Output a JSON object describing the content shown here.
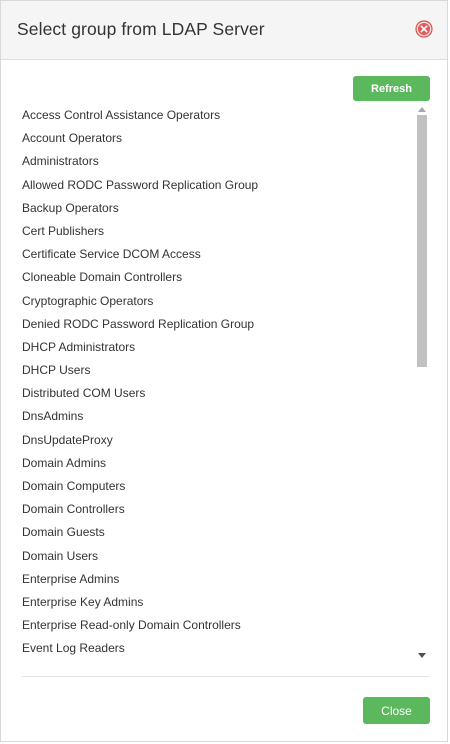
{
  "dialog": {
    "title": "Select group from LDAP Server",
    "close_icon": "close-circle-icon",
    "accent_color": "#5cb85c",
    "close_icon_color": "#e25c5c"
  },
  "toolbar": {
    "refresh_label": "Refresh"
  },
  "groups": [
    "Access Control Assistance Operators",
    "Account Operators",
    "Administrators",
    "Allowed RODC Password Replication Group",
    "Backup Operators",
    "Cert Publishers",
    "Certificate Service DCOM Access",
    "Cloneable Domain Controllers",
    "Cryptographic Operators",
    "Denied RODC Password Replication Group",
    "DHCP Administrators",
    "DHCP Users",
    "Distributed COM Users",
    "DnsAdmins",
    "DnsUpdateProxy",
    "Domain Admins",
    "Domain Computers",
    "Domain Controllers",
    "Domain Guests",
    "Domain Users",
    "Enterprise Admins",
    "Enterprise Key Admins",
    "Enterprise Read-only Domain Controllers",
    "Event Log Readers"
  ],
  "footer": {
    "close_label": "Close"
  }
}
